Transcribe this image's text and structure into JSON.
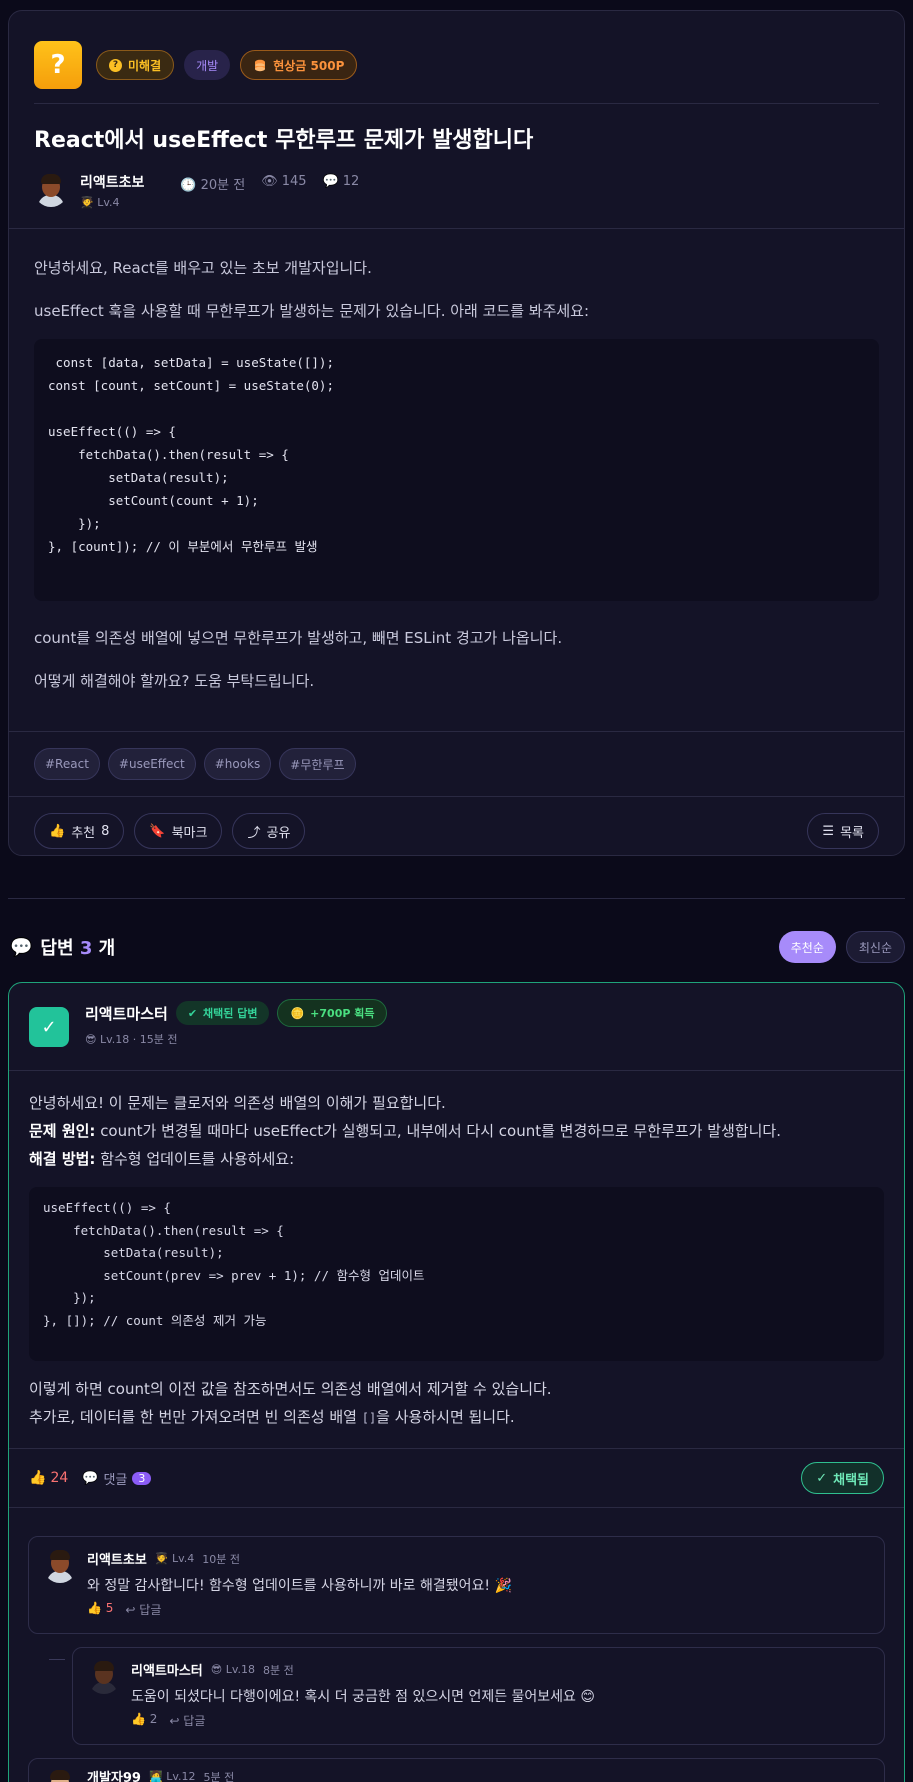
{
  "question": {
    "status_badge": "미해결",
    "category": "개발",
    "reward": "현상금 500P",
    "title": "React에서 useEffect 무한루프 문제가 발생합니다",
    "author": {
      "name": "리액트초보",
      "level": "Lv.4"
    },
    "meta": {
      "time": "20분 전",
      "views": "145",
      "comments": "12"
    },
    "body": {
      "p1": "안녕하세요, React를 배우고 있는 초보 개발자입니다.",
      "p2": "useEffect 훅을 사용할 때 무한루프가 발생하는 문제가 있습니다. 아래 코드를 봐주세요:",
      "code": [
        " const [data, setData] = useState([]);",
        "const [count, setCount] = useState(0);",
        "",
        "useEffect(() => {",
        "    fetchData().then(result => {",
        "        setData(result);",
        "        setCount(count + 1);",
        "    });",
        "}, [count]); // 이 부분에서 무한루프 발생"
      ],
      "p3": "count를 의존성 배열에 넣으면 무한루프가 발생하고, 빼면 ESLint 경고가 나옵니다.",
      "p4": "어떻게 해결해야 할까요? 도움 부탁드립니다."
    },
    "tags": [
      "#React",
      "#useEffect",
      "#hooks",
      "#무한루프"
    ],
    "actions": {
      "like": "추천",
      "like_count": "8",
      "bookmark": "북마크",
      "share": "공유",
      "list": "목록"
    }
  },
  "answers": {
    "title": "답변",
    "count": "3",
    "suffix": "개",
    "sort_recommended": "추천순",
    "sort_latest": "최신순"
  },
  "answer1": {
    "author": "리액트마스터",
    "accepted_badge": "채택된 답변",
    "earned": "+700P 획득",
    "meta": "Lv.18 · 15분 전",
    "line1": "안녕하세요! 이 문제는 클로저와 의존성 배열의 이해가 필요합니다.",
    "line2_label": "문제 원인:",
    "line2": " count가 변경될 때마다 useEffect가 실행되고, 내부에서 다시 count를 변경하므로 무한루프가 발생합니다.",
    "line3_label": "해결 방법:",
    "line3": " 함수형 업데이트를 사용하세요:",
    "code": [
      "useEffect(() => {",
      "    fetchData().then(result => {",
      "        setData(result);",
      "        setCount(prev => prev + 1); // 함수형 업데이트",
      "    });",
      "}, []); // count 의존성 제거 가능"
    ],
    "line4": "이렇게 하면 count의 이전 값을 참조하면서도 의존성 배열에서 제거할 수 있습니다.",
    "line5_pre": "추가로, 데이터를 한 번만 가져오려면 빈 의존성 배열 ",
    "line5_code": "[]",
    "line5_post": "을 사용하시면 됩니다.",
    "likes": "24",
    "comments_label": "댓글",
    "comments_count": "3",
    "accepted_button": "채택됨"
  },
  "comments": [
    {
      "name": "리액트초보",
      "level": "Lv.4",
      "time": "10분 전",
      "text": "와 정말 감사합니다! 함수형 업데이트를 사용하니까 바로 해결됐어요! 🎉",
      "likes": "5",
      "reply": "답글"
    },
    {
      "name": "리액트마스터",
      "level": "Lv.18",
      "time": "8분 전",
      "text": "도움이 되셨다니 다행이에요! 혹시 더 궁금한 점 있으시면 언제든 물어보세요 😊",
      "likes": "2",
      "reply": "답글"
    },
    {
      "name": "개발자99",
      "level": "Lv.12",
      "time": "5분 전"
    }
  ]
}
